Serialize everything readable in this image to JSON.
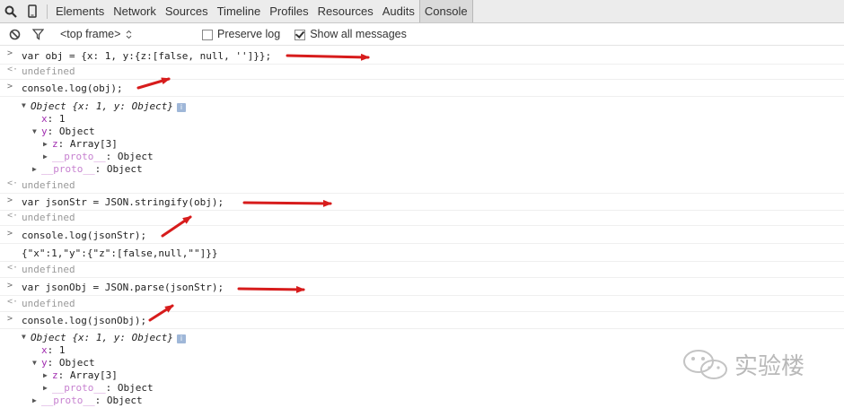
{
  "toolbar": {
    "tabs": [
      "Elements",
      "Network",
      "Sources",
      "Timeline",
      "Profiles",
      "Resources",
      "Audits",
      "Console"
    ],
    "active_tab": "Console"
  },
  "filter_bar": {
    "frame": "<top frame>",
    "preserve_log": "Preserve log",
    "show_all": "Show all messages"
  },
  "console": {
    "l1": "var obj = {x: 1, y:{z:[false, null, '']}};",
    "undefined": "undefined",
    "l2": "console.log(obj);",
    "obj_head": "Object {x: 1, y: Object}",
    "x_key": "x",
    "x_val": ": 1",
    "y_key": "y",
    "y_val": ": Object",
    "z_key": "z",
    "z_val": ": Array[3]",
    "proto_key": "__proto__",
    "proto_val": ": Object",
    "l3": "var jsonStr = JSON.stringify(obj);",
    "l4": "console.log(jsonStr);",
    "json_out": "{\"x\":1,\"y\":{\"z\":[false,null,\"\"]}}",
    "l5": "var jsonObj = JSON.parse(jsonStr);",
    "l6": "console.log(jsonObj);"
  },
  "watermark": "实验楼",
  "colors": {
    "arrow": "#d71c1c",
    "property": "#a12db0"
  }
}
